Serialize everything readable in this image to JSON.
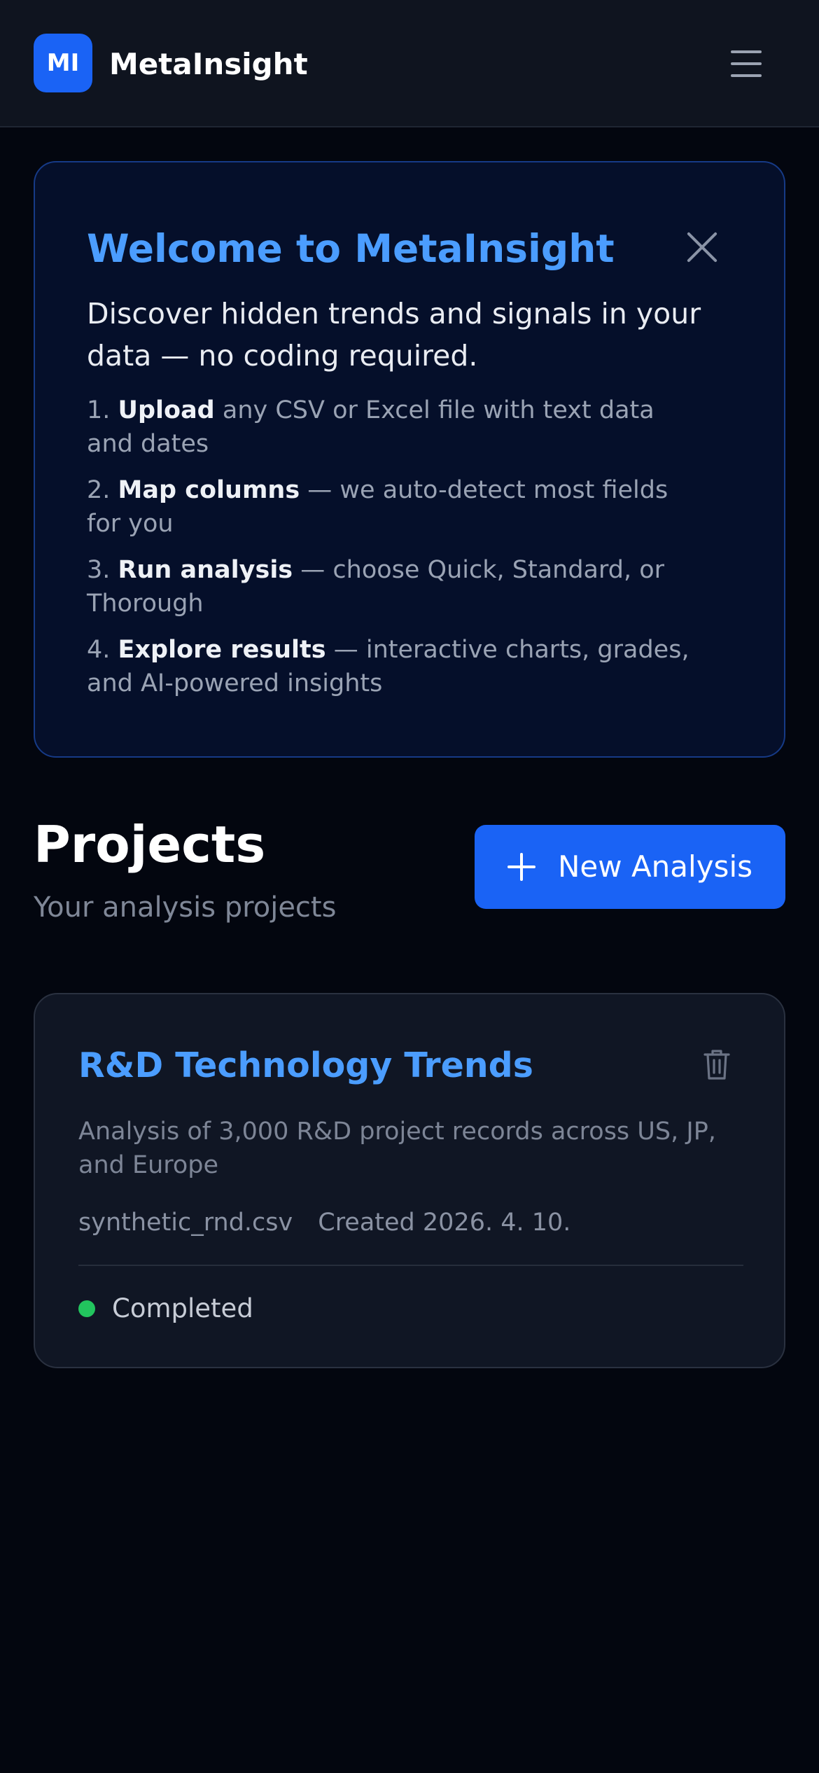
{
  "header": {
    "logo_text": "MI",
    "app_name": "MetaInsight",
    "menu_icon": "hamburger-menu-icon"
  },
  "welcome": {
    "title": "Welcome to MetaInsight",
    "lead": "Discover hidden trends and signals in your data — no coding required.",
    "close_icon": "close-icon",
    "steps": [
      {
        "number": "1.",
        "bold": "Upload",
        "rest": " any CSV or Excel file with text data and dates"
      },
      {
        "number": "2.",
        "bold": "Map columns",
        "rest": " — we auto-detect most fields for you"
      },
      {
        "number": "3.",
        "bold": "Run analysis",
        "rest": " — choose Quick, Standard, or Thorough"
      },
      {
        "number": "4.",
        "bold": "Explore results",
        "rest": " — interactive charts, grades, and AI-powered insights"
      }
    ]
  },
  "projects": {
    "title": "Projects",
    "subtitle": "Your analysis projects",
    "new_button_label": "New Analysis",
    "new_button_icon": "plus-icon",
    "items": [
      {
        "title": "R&D Technology Trends",
        "description": "Analysis of 3,000 R&D project records across US, JP, and Europe",
        "file": "synthetic_rnd.csv",
        "created": "Created 2026. 4. 10.",
        "status": "Completed",
        "status_color": "#22c55e",
        "delete_icon": "trash-icon"
      }
    ]
  },
  "colors": {
    "accent": "#1a63f5",
    "link_blue": "#4b9dff",
    "background": "#03060f",
    "success": "#22c55e"
  }
}
